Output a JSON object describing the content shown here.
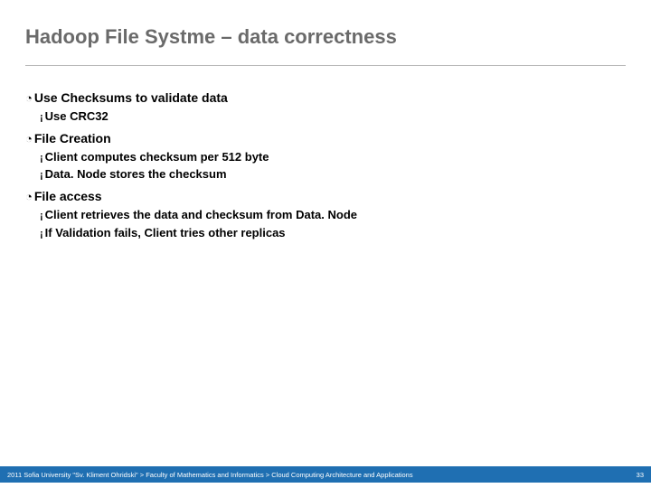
{
  "slide": {
    "title": "Hadoop File Systme – data correctness",
    "sections": [
      {
        "heading": "Use Checksums to validate data",
        "items": [
          "Use CRC32"
        ]
      },
      {
        "heading": "File Creation",
        "items": [
          "Client computes checksum per 512 byte",
          "Data. Node stores the checksum"
        ]
      },
      {
        "heading": "File access",
        "items": [
          "Client retrieves the data and checksum from Data. Node",
          "If Validation fails, Client tries other replicas"
        ]
      }
    ]
  },
  "footer": {
    "text": "2011 Sofia University \"Sv. Kliment Ohridski\" > Faculty of Mathematics and Informatics > Cloud Computing Architecture and Applications",
    "page": "33"
  },
  "bullets": {
    "l1": "◔",
    "l2": "¡"
  }
}
